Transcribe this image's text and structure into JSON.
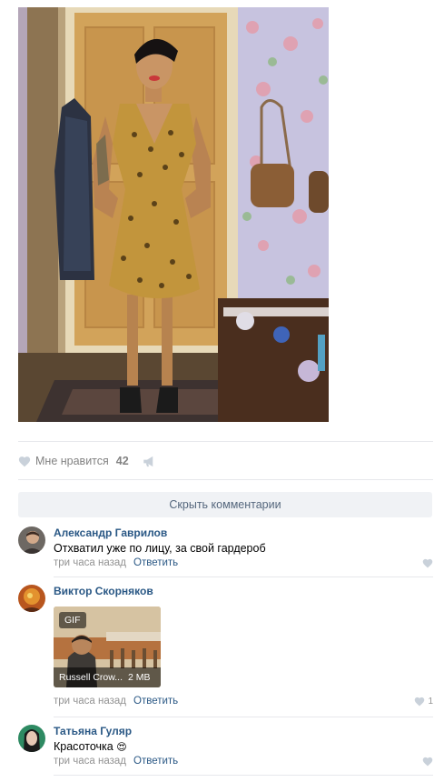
{
  "post": {
    "photo_icon": "photo-person-in-leopard-dress"
  },
  "actions": {
    "like_label": "Мне нравится",
    "like_count": "42",
    "like_icon": "heart-icon",
    "share_icon": "megaphone-icon"
  },
  "comments_block": {
    "hide_label": "Скрыть комментарии",
    "items": [
      {
        "author": "Александр Гаврилов",
        "text": "Отхватил уже по лицу, за свой гардероб",
        "time": "три часа назад",
        "reply": "Ответить",
        "likes": ""
      },
      {
        "author": "Виктор Скорняков",
        "text": "",
        "attachment": {
          "badge": "GIF",
          "title": "Russell Crow...",
          "size": "2 MB"
        },
        "time": "три часа назад",
        "reply": "Ответить",
        "likes": "1"
      },
      {
        "author": "Татьяна Гуляр",
        "text": "Красоточка",
        "emoji": "😍",
        "time": "три часа назад",
        "reply": "Ответить",
        "likes": ""
      }
    ]
  },
  "colors": {
    "link": "#2a5885",
    "muted": "#939393",
    "divider": "#e7e8ec",
    "button_bg": "#f0f2f5"
  }
}
